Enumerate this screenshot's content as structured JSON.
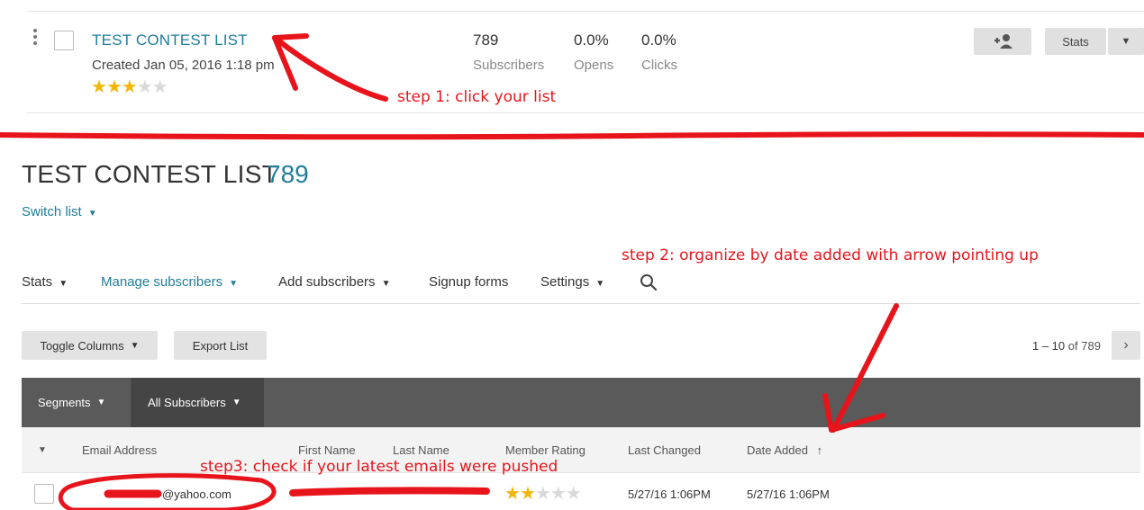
{
  "list_row": {
    "title": "TEST CONTEST LIST",
    "created": "Created Jan 05, 2016 1:18 pm",
    "rating": 3,
    "rating_max": 5,
    "metrics": [
      {
        "value": "789",
        "label": "Subscribers"
      },
      {
        "value": "0.0%",
        "label": "Opens"
      },
      {
        "value": "0.0%",
        "label": "Clicks"
      }
    ],
    "stats_label": "Stats",
    "add_subscriber_icon": "add-person-icon",
    "dropdown_icon": "chevron-down-icon"
  },
  "annotations": {
    "step1": "step 1: click your list",
    "step2": "step 2: organize by date added with arrow pointing up",
    "step3": "step3: check if your latest emails were pushed",
    "color": "#e8141b"
  },
  "page": {
    "title": "TEST CONTEST LIST",
    "count": "789",
    "switch_list": "Switch list"
  },
  "nav": {
    "items": [
      {
        "label": "Stats"
      },
      {
        "label": "Manage subscribers"
      },
      {
        "label": "Add subscribers"
      },
      {
        "label": "Signup forms"
      },
      {
        "label": "Settings"
      }
    ],
    "search_icon": "search-icon"
  },
  "toolbar": {
    "toggle_columns": "Toggle Columns",
    "export_list": "Export List",
    "pager": {
      "range": "1 – 10",
      "of": "of 789"
    }
  },
  "segments": {
    "segments_label": "Segments",
    "all_subscribers_label": "All Subscribers"
  },
  "table": {
    "columns": [
      "Email Address",
      "First Name",
      "Last Name",
      "Member Rating",
      "Last Changed",
      "Date Added"
    ],
    "sort_icon": "arrow-up-icon",
    "rows": [
      {
        "email": "@yahoo.com",
        "first_name": "",
        "last_name": "",
        "rating": 2,
        "last_changed": "5/27/16 1:06PM",
        "date_added": "5/27/16 1:06PM"
      }
    ]
  },
  "colors": {
    "accent": "#207c9a",
    "star": "#f2b70a",
    "dark_bar": "#5a5a5a"
  }
}
